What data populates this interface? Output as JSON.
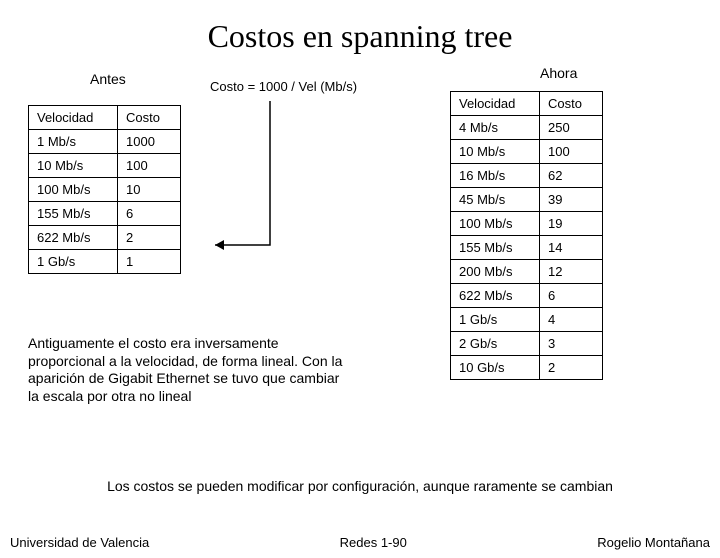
{
  "title": "Costos en spanning tree",
  "labels": {
    "antes": "Antes",
    "ahora": "Ahora",
    "formula": "Costo = 1000 / Vel (Mb/s)"
  },
  "tableLeft": {
    "headers": [
      "Velocidad",
      "Costo"
    ],
    "rows": [
      [
        "1 Mb/s",
        "1000"
      ],
      [
        "10 Mb/s",
        "100"
      ],
      [
        "100 Mb/s",
        "10"
      ],
      [
        "155 Mb/s",
        "6"
      ],
      [
        "622 Mb/s",
        "2"
      ],
      [
        "1 Gb/s",
        "1"
      ]
    ]
  },
  "tableRight": {
    "headers": [
      "Velocidad",
      "Costo"
    ],
    "rows": [
      [
        "4 Mb/s",
        "250"
      ],
      [
        "10 Mb/s",
        "100"
      ],
      [
        "16 Mb/s",
        "62"
      ],
      [
        "45 Mb/s",
        "39"
      ],
      [
        "100 Mb/s",
        "19"
      ],
      [
        "155 Mb/s",
        "14"
      ],
      [
        "200 Mb/s",
        "12"
      ],
      [
        "622 Mb/s",
        "6"
      ],
      [
        "1 Gb/s",
        "4"
      ],
      [
        "2 Gb/s",
        "3"
      ],
      [
        "10 Gb/s",
        "2"
      ]
    ]
  },
  "explain": "Antiguamente el costo era inversamente proporcional a la velocidad, de forma lineal. Con la aparición de Gigabit Ethernet se tuvo que cambiar la escala por otra no lineal",
  "footnote": "Los costos se pueden modificar por configuración, aunque raramente se cambian",
  "footer": {
    "left": "Universidad de Valencia",
    "center": "Redes 1-90",
    "right": "Rogelio Montañana"
  }
}
